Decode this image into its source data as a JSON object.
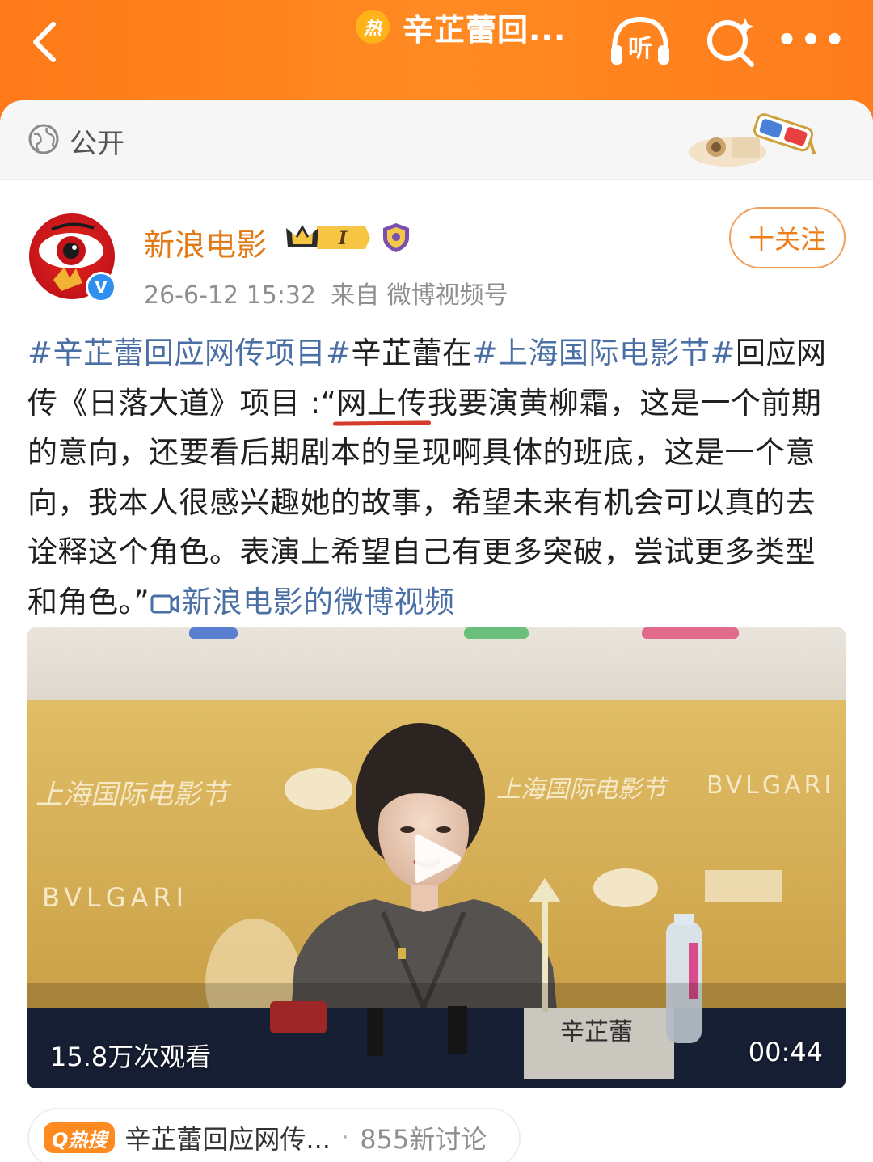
{
  "header": {
    "hot_badge": "热",
    "title": "辛芷蕾回...",
    "listen_label": "听",
    "more_label": "•••"
  },
  "visibility": {
    "label": "公开"
  },
  "author": {
    "name": "新浪电影",
    "verified_mark": "V",
    "vip_level": "I"
  },
  "post_meta": {
    "time": "26-6-12 15:32",
    "source": "来自 微博视频号"
  },
  "follow_button": {
    "label": "十关注"
  },
  "post": {
    "tag1": "#辛芷蕾回应网传项目#",
    "text1": "辛芷蕾在",
    "tag2": "#上海国际电影节#",
    "text2": "回应网传《日落大道》项目 :“",
    "underlined": "网上传",
    "text3": "我要演黄柳霜，这是一个前期的意向，还要看后期剧本的呈现啊具体的班底，这是一个意向，我本人很感兴趣她的故事，希望未来有机会可以真的去诠释这个角色。表演上希望自己有更多突破，尝试更多类型和角色。”",
    "video_link": "新浪电影的微博视频"
  },
  "video": {
    "views": "15.8万次观看",
    "duration": "00:44",
    "backdrop_text_left": "上海国际电影节",
    "backdrop_text_right": "BVLGARI",
    "nameplate": "辛芷蕾"
  },
  "hot_search": {
    "tag": "Q热搜",
    "title": "辛芷蕾回应网传...",
    "separator": "·",
    "count": "855新讨论"
  },
  "colors": {
    "header_orange": "#ff7c1c",
    "author_name": "#e07b18",
    "tag_blue": "#4a6fa5",
    "follow_orange": "#f07c16"
  }
}
